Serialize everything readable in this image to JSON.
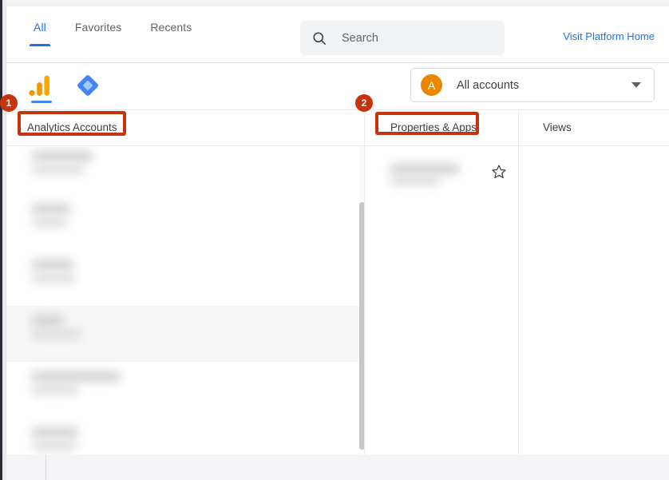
{
  "header": {
    "tabs": [
      {
        "label": "All",
        "active": true
      },
      {
        "label": "Favorites",
        "active": false
      },
      {
        "label": "Recents",
        "active": false
      }
    ],
    "search": {
      "placeholder": "Search",
      "value": "",
      "icon": "search-icon"
    },
    "platform_link": "Visit Platform Home"
  },
  "product_bar": {
    "icons": [
      {
        "name": "google-analytics-icon",
        "selected": true
      },
      {
        "name": "google-marketing-platform-icon",
        "selected": false
      }
    ],
    "account_selector": {
      "avatar_letter": "A",
      "label": "All accounts",
      "caret_icon": "chevron-down-icon"
    }
  },
  "table": {
    "columns": [
      {
        "key": "accounts",
        "label": "Analytics Accounts"
      },
      {
        "key": "properties",
        "label": "Properties & Apps"
      },
      {
        "key": "views",
        "label": "Views"
      }
    ],
    "accounts_rows": [
      {
        "redacted": true,
        "hovered": false,
        "title_width": 76,
        "sub_width": 66
      },
      {
        "redacted": true,
        "hovered": false,
        "title_width": 48,
        "sub_width": 44
      },
      {
        "redacted": true,
        "hovered": false,
        "title_width": 52,
        "sub_width": 54
      },
      {
        "redacted": true,
        "hovered": true,
        "title_width": 40,
        "sub_width": 62
      },
      {
        "redacted": true,
        "hovered": false,
        "title_width": 110,
        "sub_width": 58
      },
      {
        "redacted": true,
        "hovered": false,
        "title_width": 58,
        "sub_width": 56
      }
    ],
    "properties_rows": [
      {
        "redacted": true,
        "title_width": 86,
        "sub_width": 62,
        "star_icon": "star-outline-icon",
        "starred": false
      }
    ],
    "views_rows": []
  },
  "annotations": [
    {
      "id": 1,
      "number": "1",
      "target": "analytics-accounts-column-header"
    },
    {
      "id": 2,
      "number": "2",
      "target": "properties-and-apps-column-header"
    }
  ],
  "colors": {
    "accent_blue": "#1a73e8",
    "annotation_red": "#c5340d",
    "avatar_orange": "#ea8600",
    "text_primary": "#3c4043",
    "text_secondary": "#5f6368"
  }
}
